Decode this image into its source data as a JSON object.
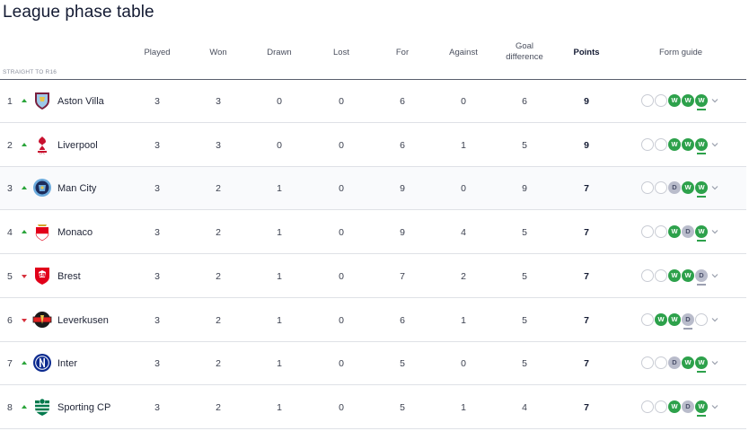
{
  "title": "League phase table",
  "section_label": "STRAIGHT TO R16",
  "columns": {
    "played": "Played",
    "won": "Won",
    "drawn": "Drawn",
    "lost": "Lost",
    "for": "For",
    "against": "Against",
    "goal_difference_1": "Goal",
    "goal_difference_2": "difference",
    "points": "Points",
    "form_guide": "Form guide"
  },
  "colors": {
    "win": "#2da14b",
    "draw": "#b9bccb",
    "up": "#2aa43a",
    "down": "#d6303c"
  },
  "rows": [
    {
      "rank": "1",
      "move": "up",
      "crest_icon": "aston-villa-crest-icon",
      "team": "Aston Villa",
      "played": "3",
      "won": "3",
      "drawn": "0",
      "lost": "0",
      "for": "6",
      "against": "0",
      "gd": "6",
      "points": "9",
      "form": [
        "",
        "",
        "W",
        "W",
        "W"
      ]
    },
    {
      "rank": "2",
      "move": "up",
      "crest_icon": "liverpool-crest-icon",
      "team": "Liverpool",
      "played": "3",
      "won": "3",
      "drawn": "0",
      "lost": "0",
      "for": "6",
      "against": "1",
      "gd": "5",
      "points": "9",
      "form": [
        "",
        "",
        "W",
        "W",
        "W"
      ]
    },
    {
      "rank": "3",
      "move": "up",
      "crest_icon": "man-city-crest-icon",
      "team": "Man City",
      "played": "3",
      "won": "2",
      "drawn": "1",
      "lost": "0",
      "for": "9",
      "against": "0",
      "gd": "9",
      "points": "7",
      "form": [
        "",
        "",
        "D",
        "W",
        "W"
      ]
    },
    {
      "rank": "4",
      "move": "up",
      "crest_icon": "monaco-crest-icon",
      "team": "Monaco",
      "played": "3",
      "won": "2",
      "drawn": "1",
      "lost": "0",
      "for": "9",
      "against": "4",
      "gd": "5",
      "points": "7",
      "form": [
        "",
        "",
        "W",
        "D",
        "W"
      ]
    },
    {
      "rank": "5",
      "move": "down",
      "crest_icon": "brest-crest-icon",
      "team": "Brest",
      "played": "3",
      "won": "2",
      "drawn": "1",
      "lost": "0",
      "for": "7",
      "against": "2",
      "gd": "5",
      "points": "7",
      "form": [
        "",
        "",
        "W",
        "W",
        "D"
      ]
    },
    {
      "rank": "6",
      "move": "down",
      "crest_icon": "leverkusen-crest-icon",
      "team": "Leverkusen",
      "played": "3",
      "won": "2",
      "drawn": "1",
      "lost": "0",
      "for": "6",
      "against": "1",
      "gd": "5",
      "points": "7",
      "form": [
        "",
        "W",
        "W",
        "D",
        ""
      ]
    },
    {
      "rank": "7",
      "move": "up",
      "crest_icon": "inter-crest-icon",
      "team": "Inter",
      "played": "3",
      "won": "2",
      "drawn": "1",
      "lost": "0",
      "for": "5",
      "against": "0",
      "gd": "5",
      "points": "7",
      "form": [
        "",
        "",
        "D",
        "W",
        "W"
      ]
    },
    {
      "rank": "8",
      "move": "up",
      "crest_icon": "sporting-cp-crest-icon",
      "team": "Sporting CP",
      "played": "3",
      "won": "2",
      "drawn": "1",
      "lost": "0",
      "for": "5",
      "against": "1",
      "gd": "4",
      "points": "7",
      "form": [
        "",
        "",
        "W",
        "D",
        "W"
      ]
    }
  ]
}
